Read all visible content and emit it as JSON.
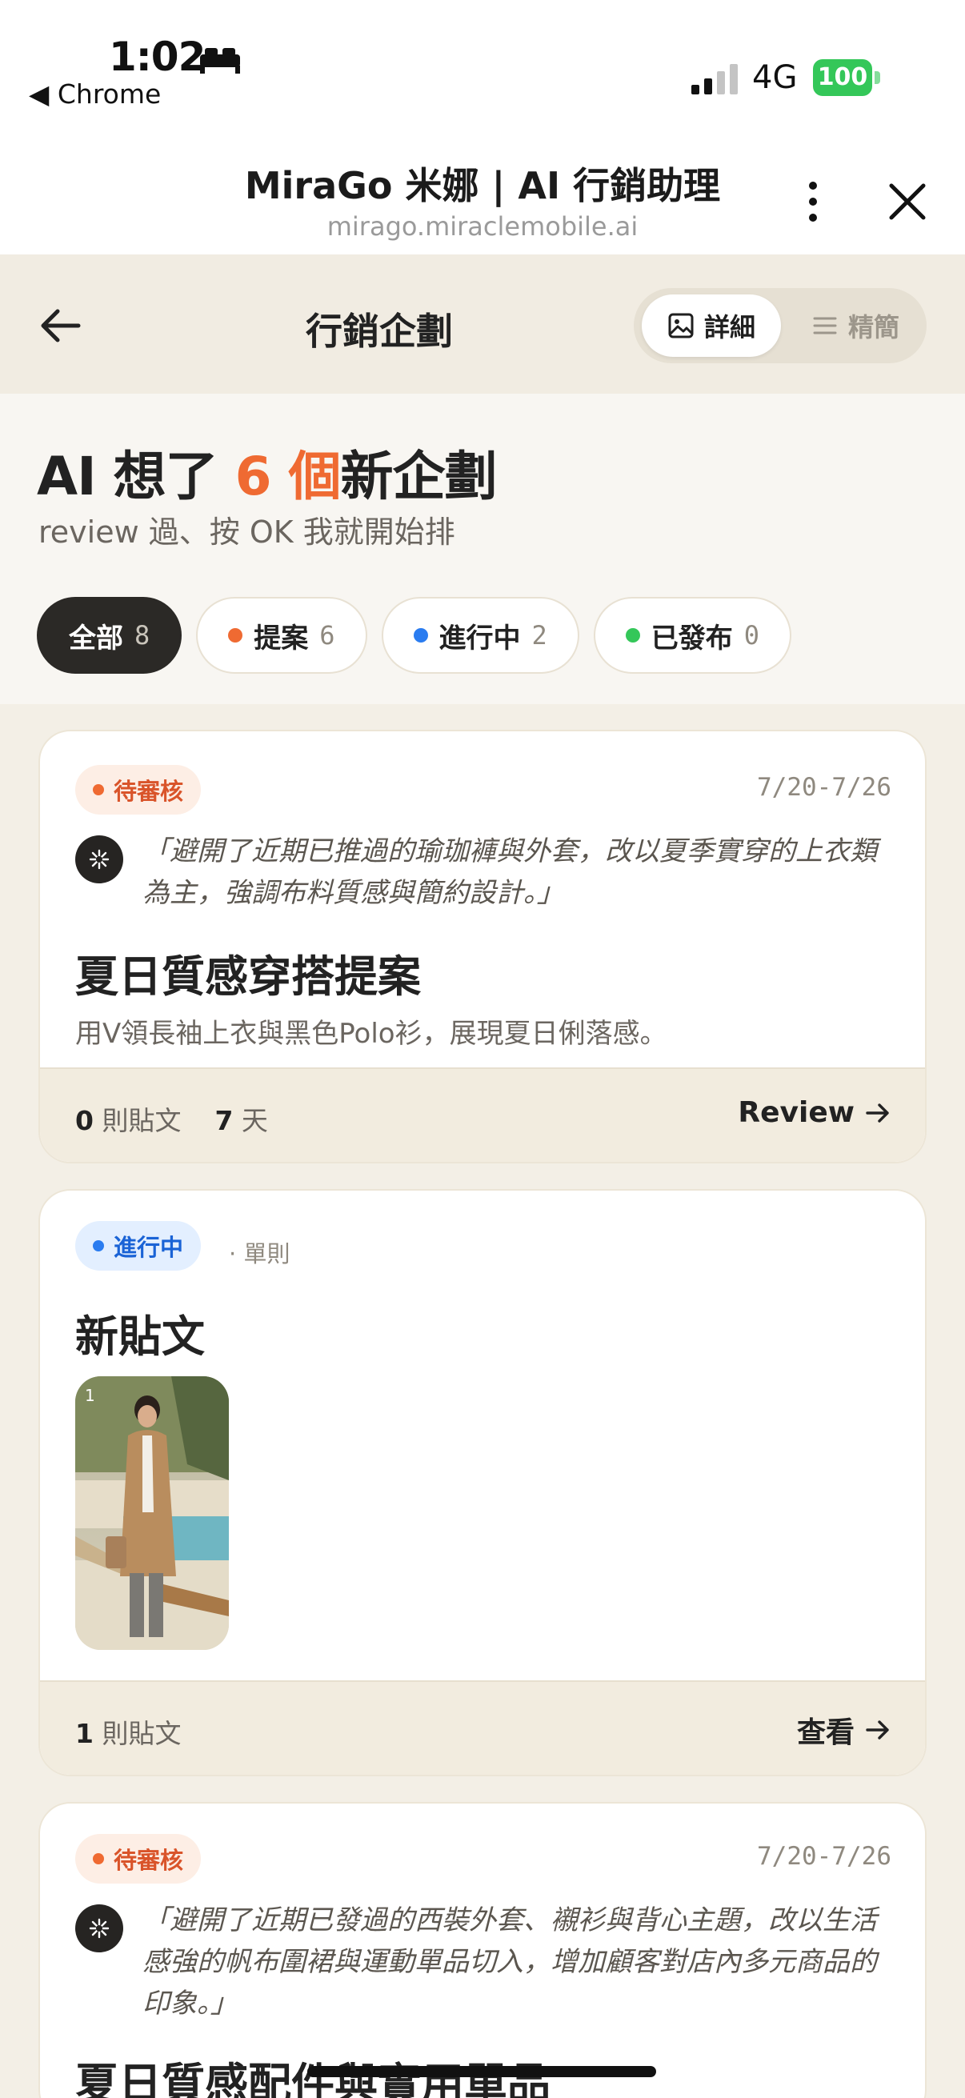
{
  "status_bar": {
    "time": "1:02",
    "back_app": "◀ Chrome",
    "network": "4G",
    "battery": "100"
  },
  "browser": {
    "title": "MiraGo 米娜 | AI 行銷助理",
    "url": "mirago.miraclemobile.ai"
  },
  "header": {
    "title": "行銷企劃",
    "view_detail": "詳細",
    "view_compact": "精簡"
  },
  "hero": {
    "title_prefix": "AI 想了 ",
    "title_count": "6 個",
    "title_suffix": "新企劃",
    "subtitle": "review 過、按 OK 我就開始排"
  },
  "filters": [
    {
      "label": "全部",
      "count": "8"
    },
    {
      "label": "提案",
      "count": "6",
      "color": "#ef6a32"
    },
    {
      "label": "進行中",
      "count": "2",
      "color": "#2a7cf0"
    },
    {
      "label": "已發布",
      "count": "0",
      "color": "#34c759"
    }
  ],
  "cards": [
    {
      "badge": "待審核",
      "date": "7/20-7/26",
      "quote": "「避開了近期已推過的瑜珈褲與外套，改以夏季實穿的上衣類為主，強調布料質感與簡約設計。」",
      "title": "夏日質感穿搭提案",
      "desc": "用V領長袖上衣與黑色Polo衫，展現夏日俐落感。",
      "posts_count": "0",
      "posts_label": "則貼文",
      "days_count": "7",
      "days_label": "天",
      "action": "Review"
    },
    {
      "badge": "進行中",
      "meta": "單則",
      "title": "新貼文",
      "thumb_num": "1",
      "posts_count": "1",
      "posts_label": "則貼文",
      "action": "查看"
    },
    {
      "badge": "待審核",
      "date": "7/20-7/26",
      "quote": "「避開了近期已發過的西裝外套、襯衫與背心主題，改以生活感強的帆布圍裙與運動單品切入，增加顧客對店內多元商品的印象。」",
      "title": "夏日質感配件與實用單品"
    }
  ],
  "colors": {
    "accent": "#ef6a32",
    "progress": "#2a7cf0",
    "published": "#34c759",
    "background": "#f3efe6"
  }
}
